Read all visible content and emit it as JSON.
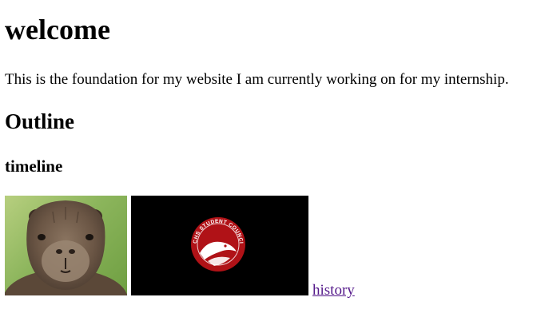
{
  "page": {
    "heading": "welcome",
    "intro": "This is the foundation for my website I am currently working on for my internship.",
    "section_heading": "Outline",
    "subsection_heading": "timeline"
  },
  "media": {
    "seal_text": "ECHS STUDENT COUNCIL",
    "seal_color": "#b01217",
    "link_label": "history",
    "link_color": "#551a8b"
  }
}
